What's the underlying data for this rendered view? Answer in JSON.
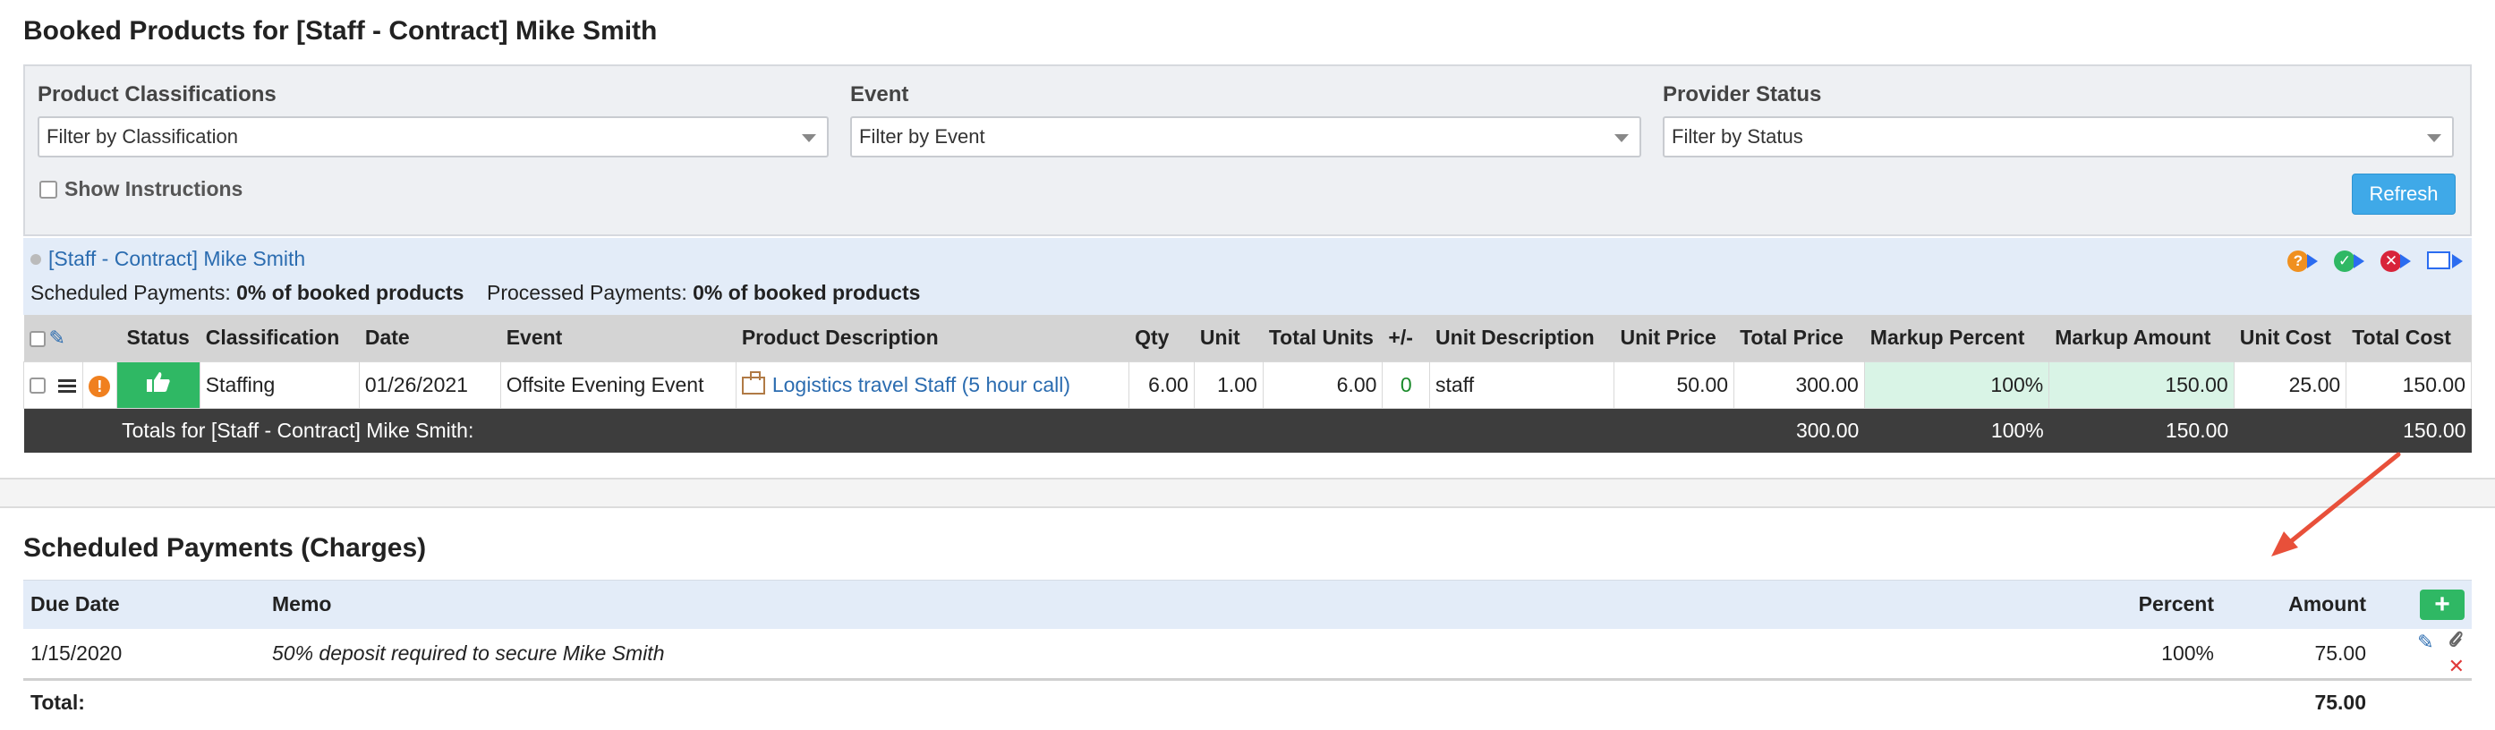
{
  "page": {
    "title": "Booked Products for [Staff - Contract] Mike Smith"
  },
  "filters": {
    "classification": {
      "label": "Product Classifications",
      "value": "Filter by Classification"
    },
    "event": {
      "label": "Event",
      "value": "Filter by Event"
    },
    "status": {
      "label": "Provider Status",
      "value": "Filter by Status"
    },
    "show_instructions": "Show Instructions",
    "refresh": "Refresh"
  },
  "provider": {
    "name": "[Staff - Contract] Mike Smith",
    "scheduled_label": "Scheduled Payments:",
    "scheduled_value": "0% of booked products",
    "processed_label": "Processed Payments:",
    "processed_value": "0% of booked products",
    "icons": [
      "question-forward-icon",
      "check-forward-icon",
      "cancel-forward-icon",
      "email-forward-icon"
    ]
  },
  "booked_table": {
    "headers": {
      "status": "Status",
      "classification": "Classification",
      "date": "Date",
      "event": "Event",
      "product": "Product Description",
      "qty": "Qty",
      "unit": "Unit",
      "total_units": "Total Units",
      "plus_minus": "+/-",
      "unit_desc": "Unit Description",
      "unit_price": "Unit Price",
      "total_price": "Total Price",
      "markup_percent": "Markup Percent",
      "markup_amount": "Markup Amount",
      "unit_cost": "Unit Cost",
      "total_cost": "Total Cost"
    },
    "row": {
      "classification": "Staffing",
      "date": "01/26/2021",
      "event": "Offsite Evening Event",
      "product": "Logistics travel Staff (5 hour call)",
      "qty": "6.00",
      "unit": "1.00",
      "total_units": "6.00",
      "plus_minus": "0",
      "unit_desc": "staff",
      "unit_price": "50.00",
      "total_price": "300.00",
      "markup_percent": "100%",
      "markup_amount": "150.00",
      "unit_cost": "25.00",
      "total_cost": "150.00"
    },
    "totals": {
      "label": "Totals for [Staff - Contract] Mike Smith:",
      "total_price": "300.00",
      "markup_percent": "100%",
      "markup_amount": "150.00",
      "total_cost": "150.00"
    }
  },
  "scheduled": {
    "title": "Scheduled Payments (Charges)",
    "headers": {
      "due_date": "Due Date",
      "memo": "Memo",
      "percent": "Percent",
      "amount": "Amount"
    },
    "rows": [
      {
        "due_date": "1/15/2020",
        "memo": "50% deposit required to secure Mike Smith",
        "percent": "100%",
        "amount": "75.00"
      }
    ],
    "total_label": "Total:",
    "total_amount": "75.00"
  },
  "colors": {
    "accent_blue": "#3fa9e8",
    "success_green": "#2fb864",
    "annotation_red": "#e8503a"
  }
}
